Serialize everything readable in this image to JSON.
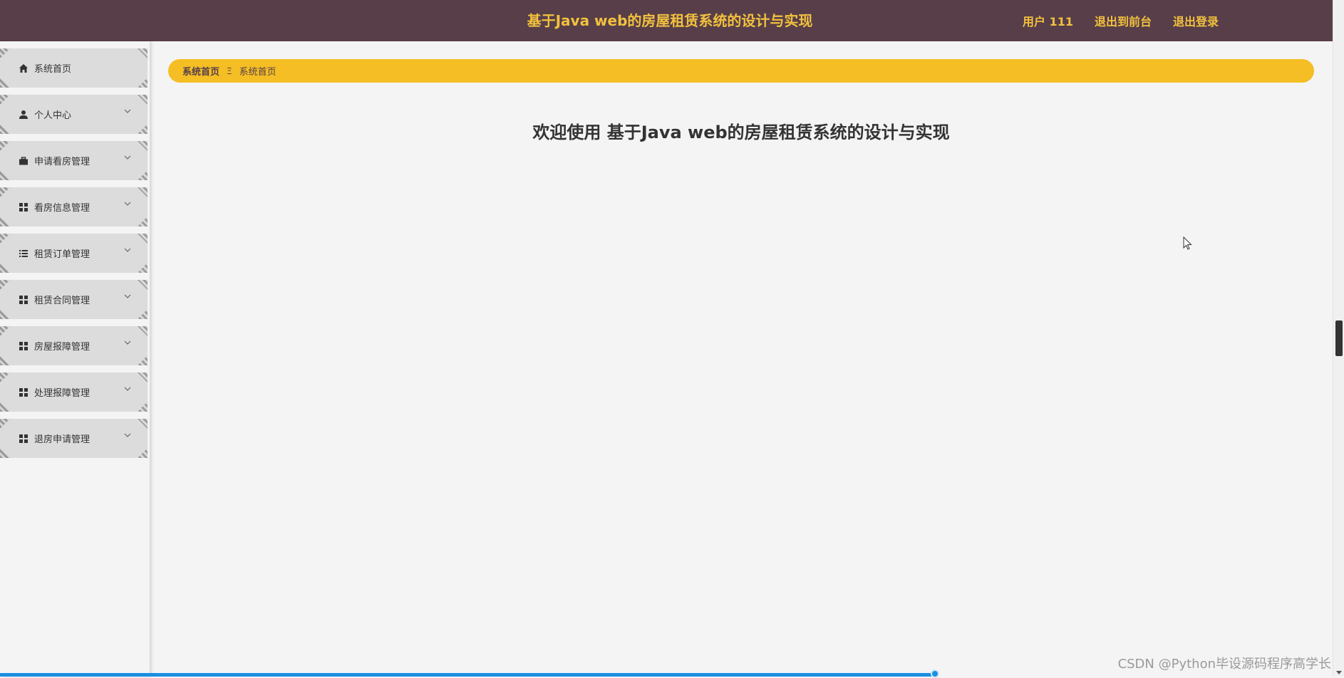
{
  "header": {
    "title": "基于Java web的房屋租赁系统的设计与实现",
    "links": [
      "用户 111",
      "退出到前台",
      "退出登录"
    ]
  },
  "sidebar": {
    "items": [
      {
        "label": "系统首页",
        "icon": "home-icon"
      },
      {
        "label": "个人中心",
        "icon": "user-icon"
      },
      {
        "label": "申请看房管理",
        "icon": "briefcase-icon"
      },
      {
        "label": "看房信息管理",
        "icon": "grid-icon"
      },
      {
        "label": "租赁订单管理",
        "icon": "list-icon"
      },
      {
        "label": "租赁合同管理",
        "icon": "grid-icon"
      },
      {
        "label": "房屋报障管理",
        "icon": "grid-icon"
      },
      {
        "label": "处理报障管理",
        "icon": "grid-icon"
      },
      {
        "label": "退房申请管理",
        "icon": "grid-icon"
      }
    ]
  },
  "breadcrumb": {
    "first": "系统首页",
    "separator": "Ξ",
    "current": "系统首页"
  },
  "main": {
    "welcome": "欢迎使用 基于Java web的房屋租赁系统的设计与实现"
  },
  "watermark": "CSDN @Python毕设源码程序高学长",
  "colors": {
    "header_bg": "#573e49",
    "accent": "#f2c13e",
    "breadcrumb_bg": "#f4be24",
    "progress": "#1a8fe0"
  }
}
